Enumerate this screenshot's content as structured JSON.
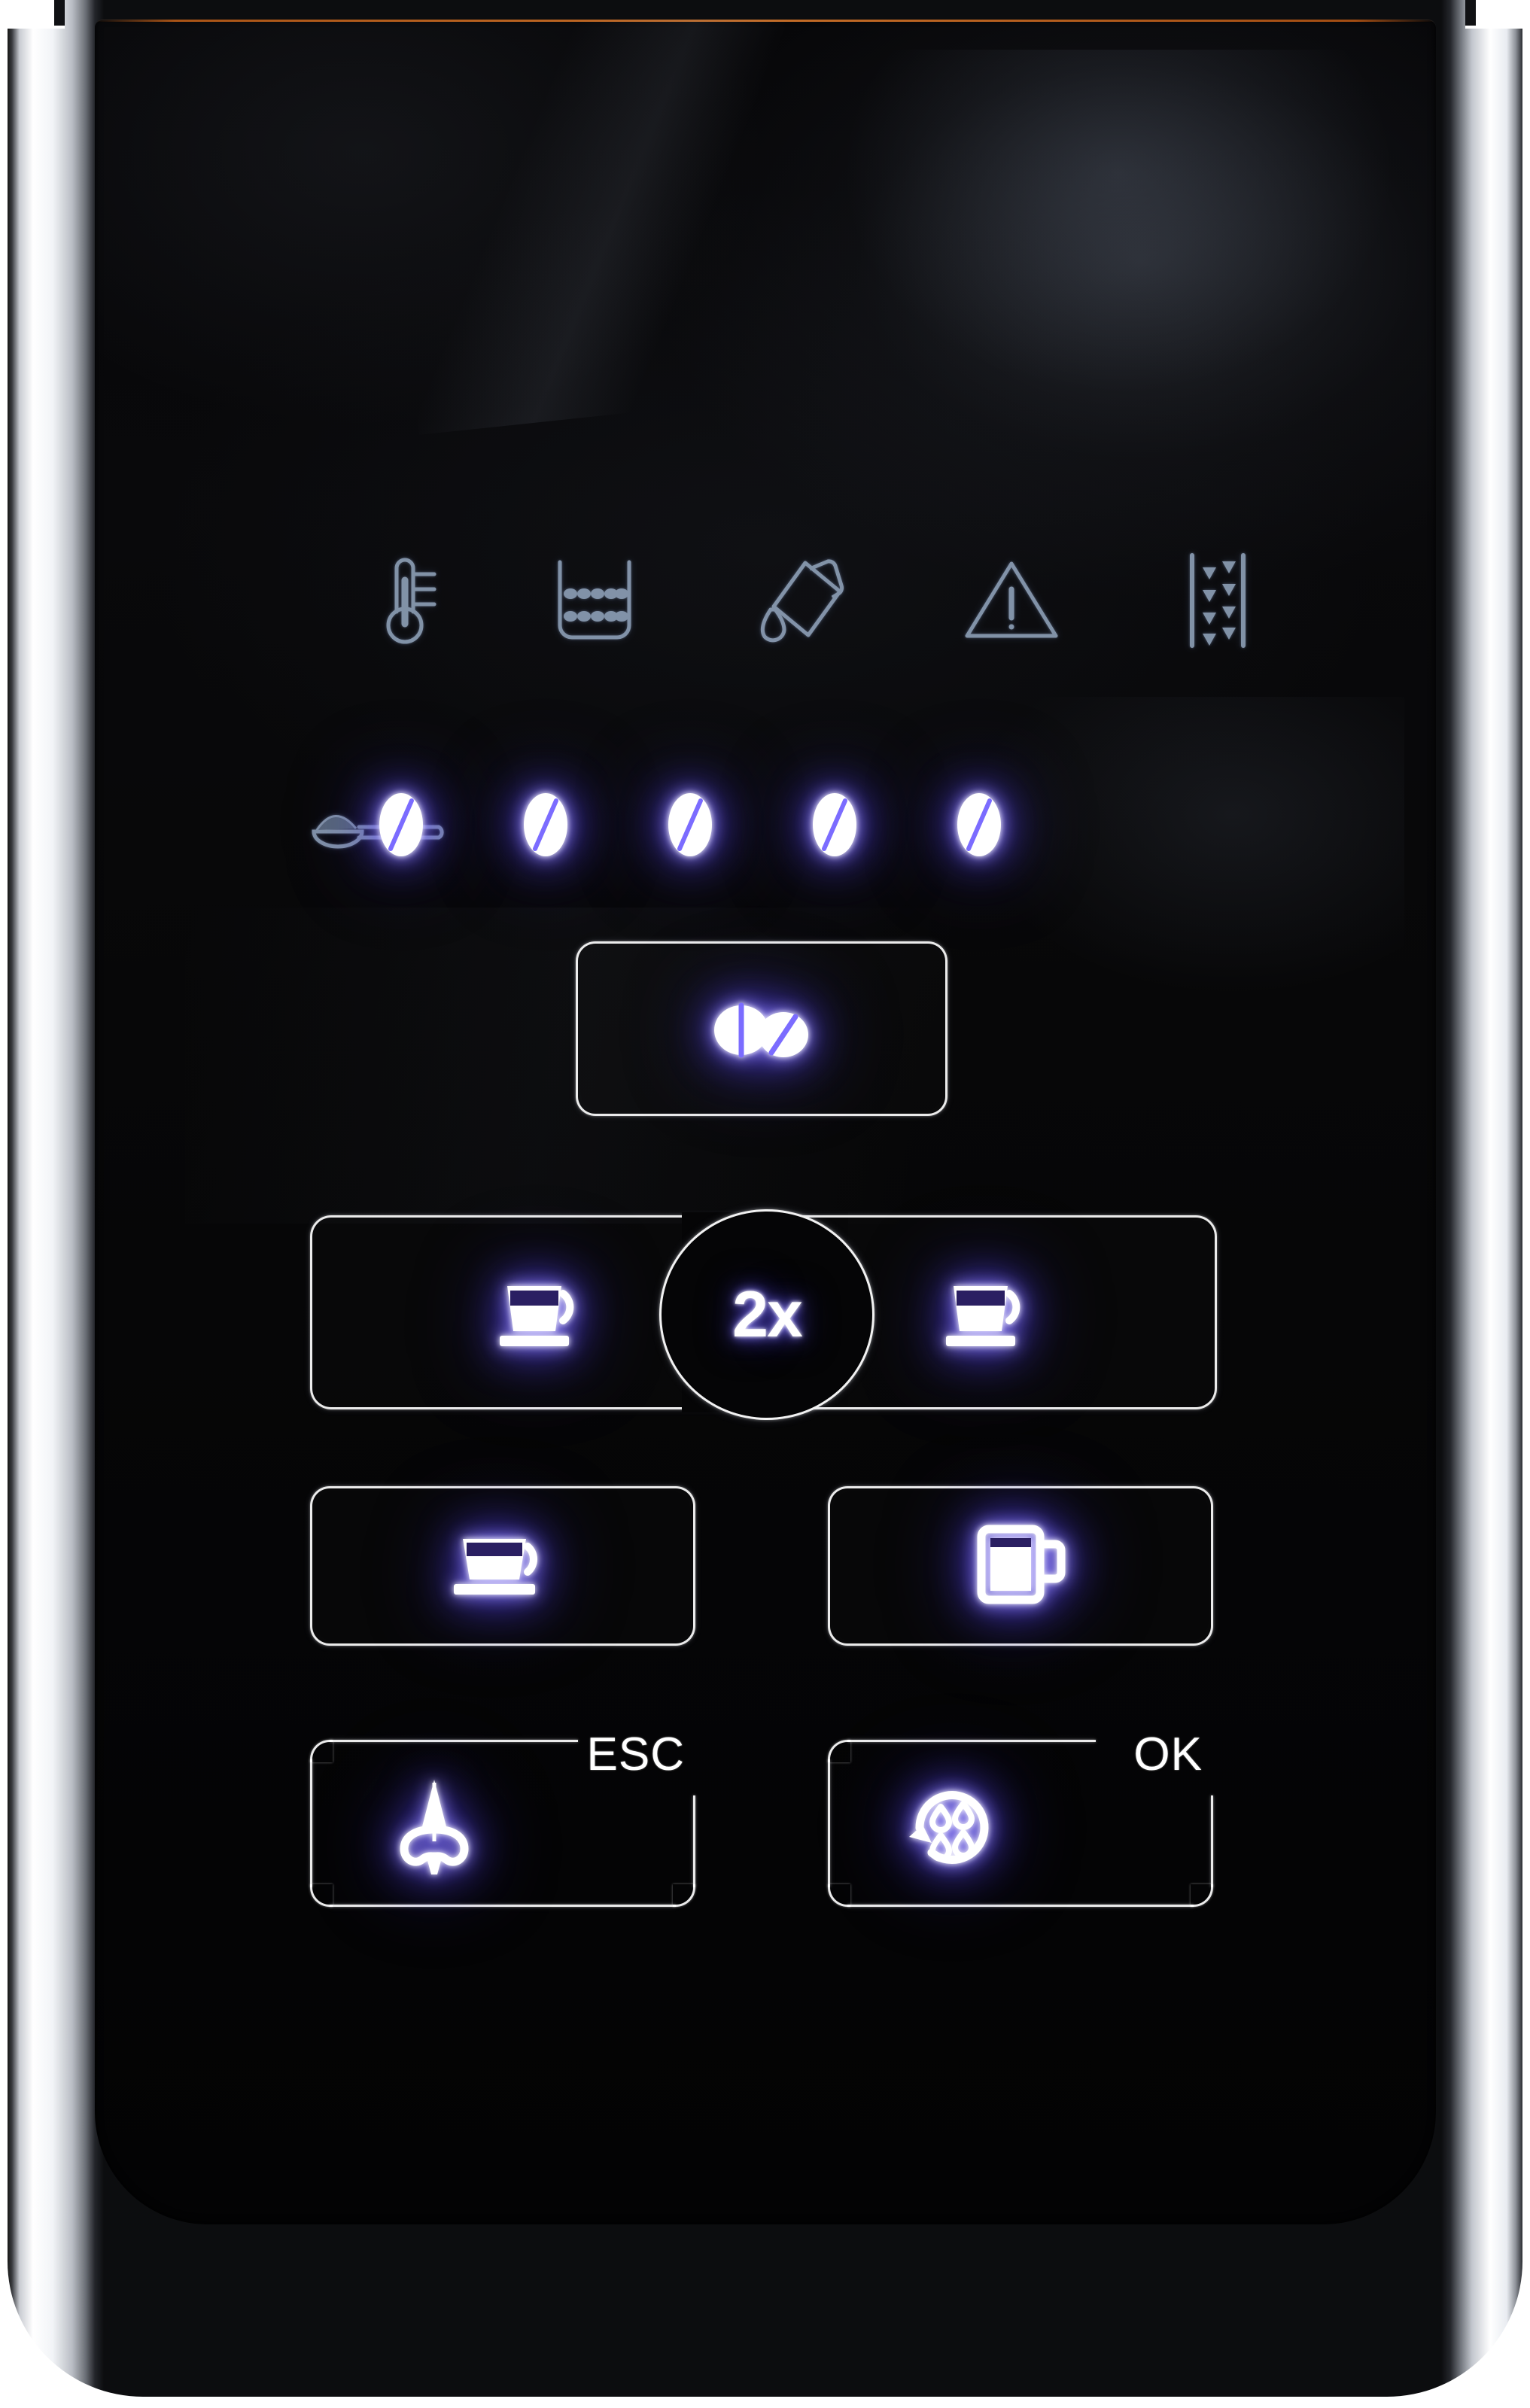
{
  "device": {
    "type": "espresso-machine-control-panel",
    "finish": "gloss-black-glass-with-chrome-bezel"
  },
  "colors": {
    "glass": "#050506",
    "bezel_chrome": "#ffffff",
    "bezel_shadow": "#23252a",
    "led_core": "#ffffff",
    "led_glow": "#6050ff",
    "etched_icon": "#8fa3bd",
    "amber_edge": "#c4601e"
  },
  "status_row": {
    "label": "machine-status-indicators",
    "icons": [
      {
        "name": "thermometer-icon",
        "meaning": "Temperature / heating up",
        "lit": false
      },
      {
        "name": "grounds-container-icon",
        "meaning": "Coffee grounds container full",
        "lit": false
      },
      {
        "name": "descale-icon",
        "meaning": "Descaling / cleaning agent required",
        "lit": false
      },
      {
        "name": "warning-triangle-icon",
        "meaning": "General fault warning",
        "lit": false
      },
      {
        "name": "water-filter-icon",
        "meaning": "Water filter change",
        "lit": false
      }
    ]
  },
  "strength_row": {
    "label": "coffee-strength-indicator",
    "ground_coffee": {
      "name": "ground-coffee-scoop-icon",
      "meaning": "Pre-ground coffee mode",
      "lit": false
    },
    "beans": [
      {
        "name": "bean-lamp-1",
        "lit": true
      },
      {
        "name": "bean-lamp-2",
        "lit": true
      },
      {
        "name": "bean-lamp-3",
        "lit": true
      },
      {
        "name": "bean-lamp-4",
        "lit": true
      },
      {
        "name": "bean-lamp-5",
        "lit": true
      }
    ],
    "lit_count": 5,
    "total": 5
  },
  "buttons": {
    "strength": {
      "name": "strength-select-button",
      "icon": "double-coffee-bean-icon",
      "label": "",
      "lit": true
    },
    "espresso_left": {
      "name": "espresso-single-left-button",
      "icon": "espresso-cup-icon",
      "label": "",
      "lit": true
    },
    "double_shot": {
      "name": "double-shot-button",
      "label": "2x",
      "lit": true
    },
    "espresso_right": {
      "name": "espresso-single-right-button",
      "icon": "espresso-cup-icon",
      "label": "",
      "lit": true
    },
    "coffee": {
      "name": "coffee-cup-button",
      "icon": "coffee-cup-saucer-icon",
      "label": "",
      "lit": true
    },
    "mug": {
      "name": "tall-mug-button",
      "icon": "tall-mug-icon",
      "label": "",
      "lit": true
    },
    "steam_esc": {
      "name": "steam-esc-button",
      "icon": "steam-nozzle-icon",
      "label": "ESC",
      "lit": true
    },
    "rinse_ok": {
      "name": "rinse-ok-button",
      "icon": "rinse-cycle-icon",
      "label": "OK",
      "lit": true
    }
  }
}
